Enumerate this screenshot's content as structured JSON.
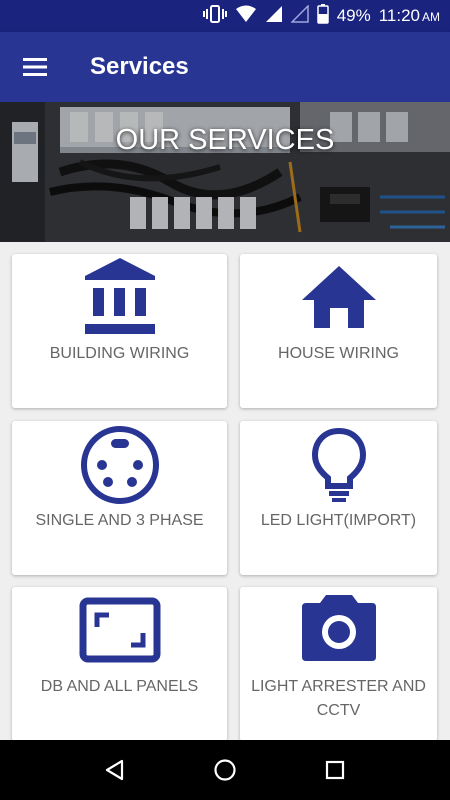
{
  "status_bar": {
    "battery_percent": "49%",
    "time": "11:20",
    "am_pm": "AM",
    "icons": [
      "vibrate-icon",
      "wifi-icon",
      "signal-icon",
      "signal-empty-icon",
      "battery-icon"
    ]
  },
  "app_bar": {
    "title": "Services",
    "menu_icon": "hamburger-menu-icon"
  },
  "hero": {
    "title": "OUR SERVICES"
  },
  "services": [
    {
      "label": "BUILDING  WIRING",
      "icon": "bank-building-icon"
    },
    {
      "label": "HOUSE WIRING",
      "icon": "house-icon"
    },
    {
      "label": "SINGLE AND 3 PHASE",
      "icon": "socket-icon"
    },
    {
      "label": "LED LIGHT(IMPORT)",
      "icon": "lightbulb-icon"
    },
    {
      "label": "DB AND ALL PANELS",
      "icon": "panel-frame-icon"
    },
    {
      "label": "LIGHT ARRESTER AND CCTV",
      "icon": "camera-icon"
    }
  ],
  "nav_bar": {
    "icons": [
      "back-icon",
      "home-icon",
      "recents-icon"
    ]
  },
  "colors": {
    "status_bar": "#1a237e",
    "app_bar": "#283593",
    "icon_accent": "#283593",
    "label_text": "#666666",
    "background": "#efefef"
  }
}
